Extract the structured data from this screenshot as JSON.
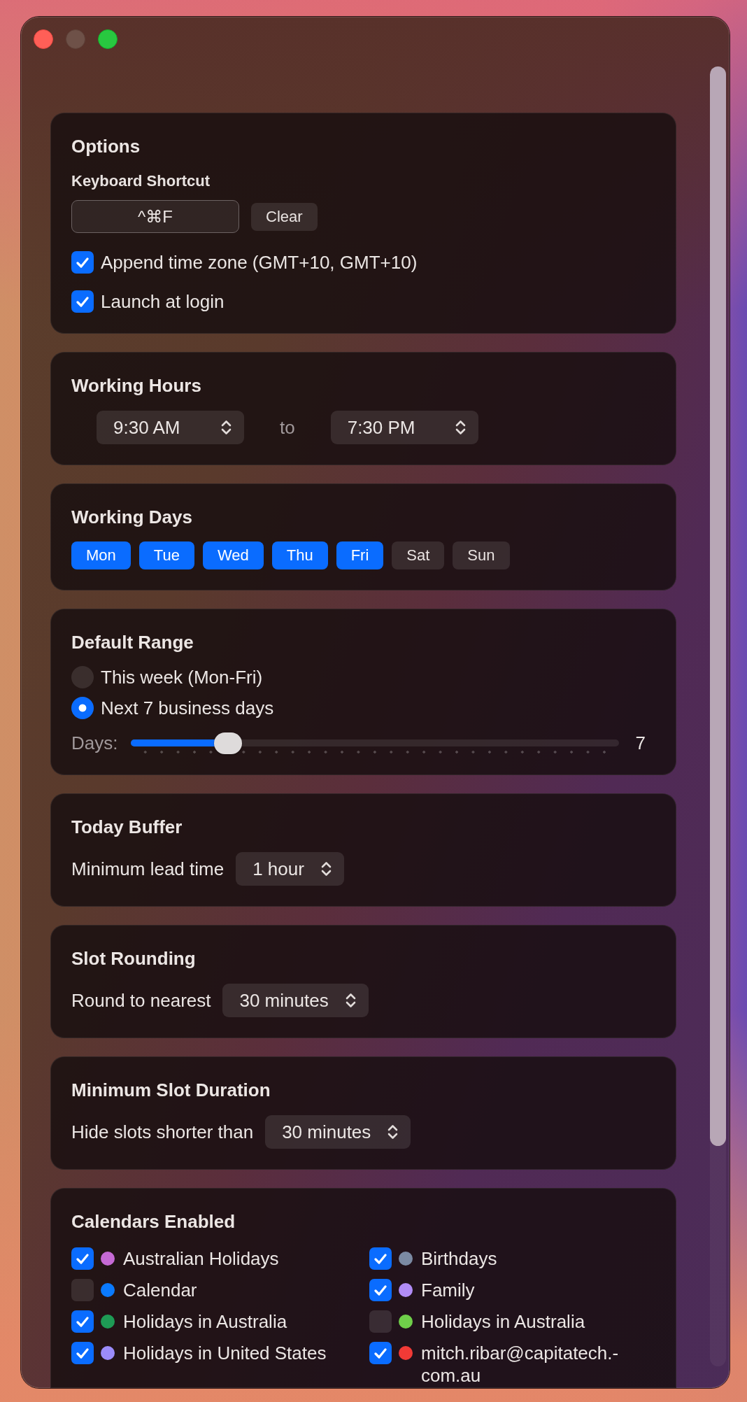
{
  "window": {
    "buttons": [
      {
        "kind": "close",
        "disabled": false
      },
      {
        "kind": "minimize",
        "disabled": true
      },
      {
        "kind": "zoom",
        "disabled": false
      }
    ]
  },
  "sections": [
    {
      "kind": "options",
      "title": "Options",
      "shortcut_label": "Keyboard Shortcut",
      "shortcut": "^⌘F",
      "clear_button": "Clear",
      "checkboxes": [
        {
          "label": "Append time zone (GMT+10, GMT+10)",
          "checked": true
        },
        {
          "label": "Launch at login",
          "checked": true
        }
      ]
    },
    {
      "kind": "time_range",
      "title": "Working Hours",
      "start": "9:30 AM",
      "separator": "to",
      "end": "7:30 PM"
    },
    {
      "kind": "day_picker",
      "title": "Working Days",
      "days": [
        {
          "label": "Mon",
          "selected": true
        },
        {
          "label": "Tue",
          "selected": true
        },
        {
          "label": "Wed",
          "selected": true
        },
        {
          "label": "Thu",
          "selected": true
        },
        {
          "label": "Fri",
          "selected": true
        },
        {
          "label": "Sat",
          "selected": false
        },
        {
          "label": "Sun",
          "selected": false
        }
      ]
    },
    {
      "kind": "range_choice",
      "title": "Default Range",
      "options": [
        {
          "label": "This week (Mon-Fri)",
          "selected": false
        },
        {
          "label": "Next 7 business days",
          "selected": true
        }
      ],
      "slider": {
        "label": "Days:",
        "level": 0.18,
        "reading": "7"
      }
    },
    {
      "kind": "dropdown",
      "title": "Today Buffer",
      "label": "Minimum lead time",
      "value": "1 hour"
    },
    {
      "kind": "dropdown",
      "title": "Slot Rounding",
      "label": "Round to nearest",
      "value": "30 minutes"
    },
    {
      "kind": "dropdown",
      "title": "Minimum Slot Duration",
      "label": "Hide slots shorter than",
      "value": "30 minutes"
    },
    {
      "kind": "calendar_list",
      "title": "Calendars Enabled",
      "calendars": [
        {
          "name": "Australian Holidays",
          "checked": true,
          "color": "#c66ad5"
        },
        {
          "name": "Birthdays",
          "checked": true,
          "color": "#7b8aa3"
        },
        {
          "name": "Calendar",
          "checked": false,
          "color": "#0a7aff"
        },
        {
          "name": "Family",
          "checked": true,
          "color": "#b18cf6"
        },
        {
          "name": "Holidays in Australia",
          "checked": true,
          "color": "#1e9b55"
        },
        {
          "name": "Holidays in Australia",
          "checked": false,
          "color": "#6fcf4a"
        },
        {
          "name": "Holidays in United States",
          "checked": true,
          "color": "#9b8cfa"
        },
        {
          "name": "mitch.ribar@capitatech.-com.au",
          "checked": true,
          "color": "#f23a36"
        }
      ]
    }
  ]
}
